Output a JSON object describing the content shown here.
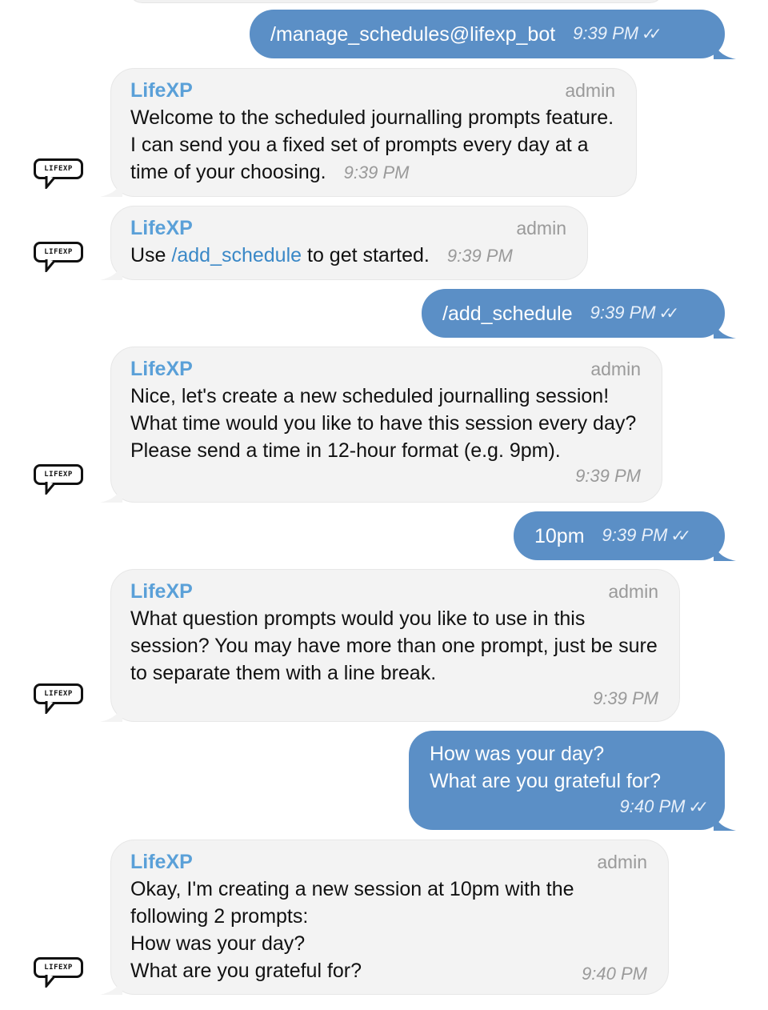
{
  "bot": {
    "name": "LifeXP",
    "role": "admin",
    "avatar_text": "LIFEXP"
  },
  "messages": [
    {
      "text": "/manage_schedules@lifexp_bot",
      "time": "9:39 PM"
    },
    {
      "text": "Welcome to the scheduled journalling prompts feature. I can send you a fixed set of prompts every day at a time of your choosing.",
      "time": "9:39 PM"
    },
    {
      "text_before": "Use ",
      "link": "/add_schedule",
      "text_after": " to get started.",
      "time": "9:39 PM"
    },
    {
      "text": "/add_schedule",
      "time": "9:39 PM"
    },
    {
      "text": "Nice, let's create a new scheduled journalling session! What time would you like to have this session every day? Please send a time in 12-hour format (e.g. 9pm).",
      "time": "9:39 PM"
    },
    {
      "text": "10pm",
      "time": "9:39 PM"
    },
    {
      "text": "What question prompts would you like to use in this session? You may have more than one prompt, just be sure to separate them with a line break.",
      "time": "9:39 PM"
    },
    {
      "text": "How was your day?\nWhat are you grateful for?",
      "time": "9:40 PM"
    },
    {
      "text": "Okay, I'm creating a new session at 10pm with the following 2 prompts:\nHow was your day?\nWhat are you grateful for?",
      "time": "9:40 PM"
    }
  ],
  "icons": {
    "read_receipt": "double-check-icon",
    "avatar": "lifexp-speech-bubble-icon"
  },
  "colors": {
    "outgoing": "#5b8fc6",
    "incoming": "#f3f3f3",
    "sender_name": "#5aa0d8",
    "link": "#3a88c7"
  }
}
